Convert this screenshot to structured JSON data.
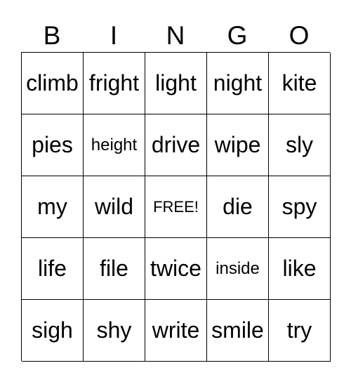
{
  "header": [
    "B",
    "I",
    "N",
    "G",
    "O"
  ],
  "rows": [
    [
      "climb",
      "fright",
      "light",
      "night",
      "kite"
    ],
    [
      "pies",
      "height",
      "drive",
      "wipe",
      "sly"
    ],
    [
      "my",
      "wild",
      "FREE!",
      "die",
      "spy"
    ],
    [
      "life",
      "file",
      "twice",
      "inside",
      "like"
    ],
    [
      "sigh",
      "shy",
      "write",
      "smile",
      "try"
    ]
  ]
}
